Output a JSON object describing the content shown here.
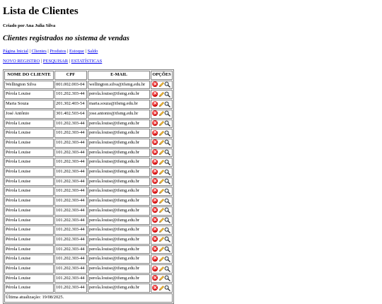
{
  "page": {
    "title": "Lista de Clientes",
    "author": "Criado por Ana Julia Silva",
    "subtitle": "Clientes registrados no sistema de vendas"
  },
  "nav": {
    "items": [
      "Página Inicial",
      "Clientes",
      "Produtos",
      "Estoque",
      "Saldo"
    ],
    "separator": "|"
  },
  "actions": {
    "items": [
      "NOVO REGISTRO",
      "PESQUISAR",
      "ESTATÍSTICAS"
    ],
    "separator": "|"
  },
  "table": {
    "headers": [
      "NOME DO CLIENTE",
      "CPF",
      "E-MAIL",
      "OPÇÕES"
    ],
    "rows": [
      [
        "Wellington Silva",
        "001.002.003-04",
        "wellington.silva@ifsmg.edu.br"
      ],
      [
        "Pérola Louise",
        "101.202.303-44",
        "perola.louise@ifsmg.edu.br"
      ],
      [
        "Maria Souza",
        "201.302.403-54",
        "maria.souza@ifsmg.edu.br"
      ],
      [
        "José Antônio",
        "301.402.503-64",
        "jose.antonio@ifsmg.edu.br"
      ],
      [
        "Pérola Louise",
        "101.202.303-44",
        "perola.louise@ifsmg.edu.br"
      ],
      [
        "Pérola Louise",
        "101.202.303-44",
        "perola.louise@ifsmg.edu.br"
      ],
      [
        "Pérola Louise",
        "101.202.303-44",
        "perola.louise@ifsmg.edu.br"
      ],
      [
        "Pérola Louise",
        "101.202.303-44",
        "perola.louise@ifsmg.edu.br"
      ],
      [
        "Pérola Louise",
        "101.202.303-44",
        "perola.louise@ifsmg.edu.br"
      ],
      [
        "Pérola Louise",
        "101.202.303-44",
        "perola.louise@ifsmg.edu.br"
      ],
      [
        "Pérola Louise",
        "101.202.303-44",
        "perola.louise@ifsmg.edu.br"
      ],
      [
        "Pérola Louise",
        "101.202.303-44",
        "perola.louise@ifsmg.edu.br"
      ],
      [
        "Pérola Louise",
        "101.202.303-44",
        "perola.louise@ifsmg.edu.br"
      ],
      [
        "Pérola Louise",
        "101.202.303-44",
        "perola.louise@ifsmg.edu.br"
      ],
      [
        "Pérola Louise",
        "101.202.303-44",
        "perola.louise@ifsmg.edu.br"
      ],
      [
        "Pérola Louise",
        "101.202.303-44",
        "perola.louise@ifsmg.edu.br"
      ],
      [
        "Pérola Louise",
        "101.202.303-44",
        "perola.louise@ifsmg.edu.br"
      ],
      [
        "Pérola Louise",
        "101.202.303-44",
        "perola.louise@ifsmg.edu.br"
      ],
      [
        "Pérola Louise",
        "101.202.303-44",
        "perola.louise@ifsmg.edu.br"
      ],
      [
        "Pérola Louise",
        "101.202.303-44",
        "perola.louise@ifsmg.edu.br"
      ],
      [
        "Pérola Louise",
        "101.202.303-44",
        "perola.louise@ifsmg.edu.br"
      ],
      [
        "Pérola Louise",
        "101.202.303-44",
        "perola.louise@ifsmg.edu.br"
      ]
    ],
    "row_icons": [
      "delete-icon",
      "edit-icon",
      "search-icon"
    ],
    "footer": "Última atualização: 19/08/2025."
  },
  "colors": {
    "link": "#0000ee",
    "border": "#808080",
    "delete": "#cc0000",
    "edit": "#e0a020"
  }
}
